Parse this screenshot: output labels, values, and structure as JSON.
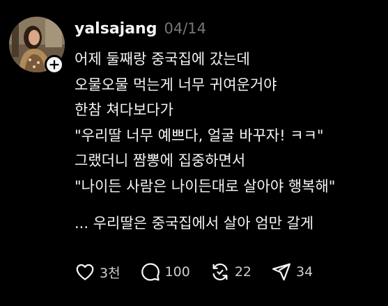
{
  "post": {
    "username": "yalsajang",
    "timestamp": "04/14",
    "lines": [
      "어제 둘째랑 중국집에 갔는데",
      "오물오물 먹는게 너무 귀여운거야",
      "한참 쳐다보다가",
      "\"우리딸 너무 예쁘다, 얼굴 바꾸자! ㅋㅋ\"",
      "그랬더니 짬뽕에 집중하면서",
      "\"나이든 사람은 나이든대로 살아야 행복해\""
    ],
    "footer_line": "... 우리딸은 중국집에서 살아 엄만 갈게"
  },
  "actions": {
    "like": {
      "icon": "heart-icon",
      "count": "3천"
    },
    "comment": {
      "icon": "comment-icon",
      "count": "100"
    },
    "repost": {
      "icon": "repost-icon",
      "count": "22"
    },
    "share": {
      "icon": "send-icon",
      "count": "34"
    }
  },
  "colors": {
    "background": "#000000",
    "text": "#f3f5f7",
    "muted": "#777777"
  }
}
